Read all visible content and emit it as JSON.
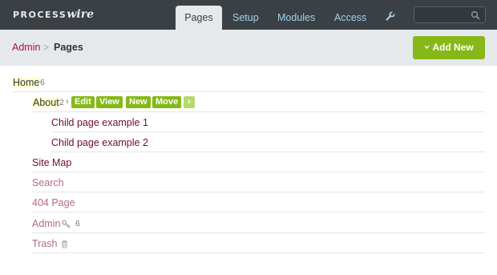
{
  "header": {
    "logo_part1": "PROCESS",
    "logo_part2": "wire",
    "nav": [
      {
        "label": "Pages",
        "active": true
      },
      {
        "label": "Setup",
        "active": false
      },
      {
        "label": "Modules",
        "active": false
      },
      {
        "label": "Access",
        "active": false
      }
    ],
    "tools_icon": "wrench-icon",
    "search": {
      "value": "",
      "placeholder": "",
      "icon": "search-icon"
    }
  },
  "breadcrumb": {
    "parent": "Admin",
    "separator": ">",
    "current": "Pages"
  },
  "add_new": {
    "icon": "chevron-down-icon",
    "label": "Add New"
  },
  "tree": {
    "home": {
      "label": "Home",
      "count": "6"
    },
    "about": {
      "label": "About",
      "count": "2",
      "arrow": "›"
    },
    "actions": [
      "Edit",
      "View",
      "New",
      "Move",
      "›"
    ],
    "child_1": {
      "label": "Child page example 1"
    },
    "child_2": {
      "label": "Child page example 2"
    },
    "site_map": {
      "label": "Site Map"
    },
    "search": {
      "label": "Search"
    },
    "page_404": {
      "label": "404 Page"
    },
    "admin": {
      "label": "Admin",
      "icon": "key-icon",
      "count": "6"
    },
    "trash": {
      "label": "Trash",
      "icon": "trash-icon"
    }
  },
  "colors": {
    "topbar": "#3b4045",
    "nav_text": "#9fd0ea",
    "accent_green": "#86b817",
    "link_dark": "#6d0b2e",
    "link_hidden": "#b16a84",
    "breadcrumb_link": "#a8123c"
  }
}
